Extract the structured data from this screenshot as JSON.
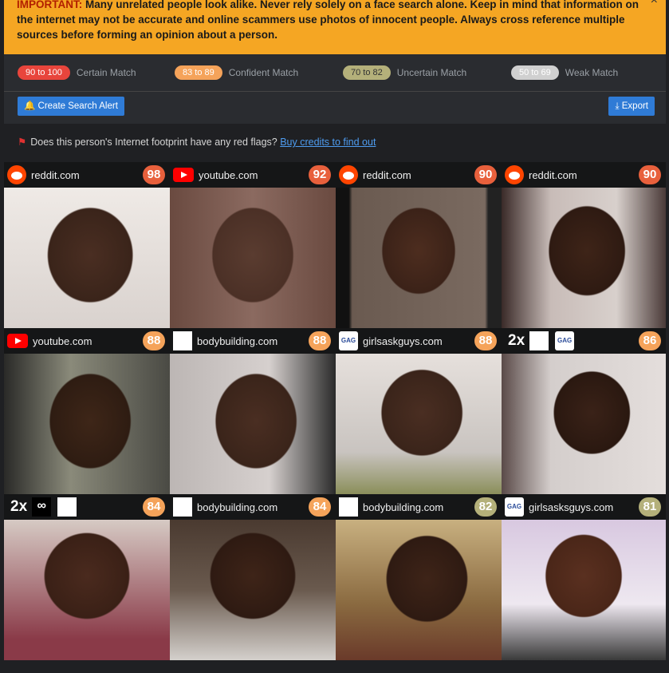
{
  "banner": {
    "important": "IMPORTANT:",
    "text": " Many unrelated people look alike. Never rely solely on a face search alone. Keep in mind that information on the internet may not be accurate and online scammers use photos of innocent people. Always cross reference multiple sources before forming an opinion about a person.",
    "close": "×"
  },
  "legend": [
    {
      "range": "90 to 100",
      "label": "Certain Match",
      "color": "#e8453c"
    },
    {
      "range": "83 to 89",
      "label": "Confident Match",
      "color": "#f5a35a"
    },
    {
      "range": "70 to 82",
      "label": "Uncertain Match",
      "color": "#b4b07a"
    },
    {
      "range": "50 to 69",
      "label": "Weak Match",
      "color": "#c8c8c8"
    }
  ],
  "toolbar": {
    "alert_label": "Create Search Alert",
    "export_label": "Export"
  },
  "redflag": {
    "text": "Does this person's Internet footprint have any red flags?",
    "link": "Buy credits to find out"
  },
  "results": [
    {
      "icon": "reddit-icon",
      "site": "reddit.com",
      "score": "98",
      "color": "#e8603c"
    },
    {
      "icon": "youtube-icon",
      "site": "youtube.com",
      "score": "92",
      "color": "#e8603c"
    },
    {
      "icon": "reddit-icon",
      "site": "reddit.com",
      "score": "90",
      "color": "#e8603c"
    },
    {
      "icon": "reddit-icon",
      "site": "reddit.com",
      "score": "90",
      "color": "#e8603c"
    },
    {
      "icon": "youtube-icon",
      "site": "youtube.com",
      "score": "88",
      "color": "#f5a35a"
    },
    {
      "icon": "blank-icon",
      "site": "bodybuilding.com",
      "score": "88",
      "color": "#f5a35a"
    },
    {
      "icon": "gag-icon",
      "site": "girlsaskguys.com",
      "score": "88",
      "color": "#f5a35a"
    },
    {
      "icon": "gag-icon",
      "site": "",
      "score": "86",
      "color": "#f5a35a",
      "count": "2x"
    },
    {
      "icon": "loop-icon",
      "site": "",
      "score": "84",
      "color": "#f5a35a",
      "count": "2x"
    },
    {
      "icon": "blank-icon",
      "site": "bodybuilding.com",
      "score": "84",
      "color": "#f5a35a"
    },
    {
      "icon": "blank-icon",
      "site": "bodybuilding.com",
      "score": "82",
      "color": "#b4b07a"
    },
    {
      "icon": "gag-icon",
      "site": "girlsasksguys.com",
      "score": "81",
      "color": "#b4b07a"
    }
  ]
}
